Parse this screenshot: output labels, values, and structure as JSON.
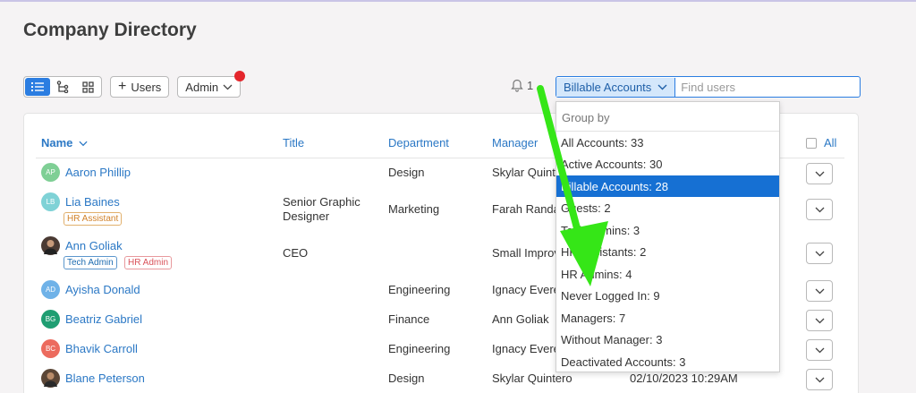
{
  "page": {
    "title": "Company Directory"
  },
  "toolbar": {
    "add_users_label": "Users",
    "role_select": "Admin"
  },
  "notifications": {
    "count": "1"
  },
  "search": {
    "filter_chip": "Billable Accounts",
    "placeholder": "Find users"
  },
  "table": {
    "headers": {
      "name": "Name",
      "title": "Title",
      "department": "Department",
      "manager": "Manager",
      "all": "All"
    },
    "rows": [
      {
        "initials": "AP",
        "avatar_color": "#7fcf95",
        "name": "Aaron Phillip",
        "title_line1": "",
        "title_line2": "",
        "department": "Design",
        "manager": "Skylar Quinte",
        "date": ""
      },
      {
        "initials": "LB",
        "avatar_color": "#7fd2d6",
        "name": "Lia Baines",
        "badge1": "HR Assistant",
        "title_line1": "Senior Graphic",
        "title_line2": "Designer",
        "department": "Marketing",
        "manager": "Farah Randa",
        "date": ""
      },
      {
        "initials": "",
        "avatar_color": "#4a3a33",
        "name": "Ann Goliak",
        "badge1": "Tech Admin",
        "badge2": "HR Admin",
        "title_line1": "CEO",
        "title_line2": "",
        "department": "",
        "manager": "Small Improv",
        "date": ""
      },
      {
        "initials": "AD",
        "avatar_color": "#6fb2e8",
        "name": "Ayisha Donald",
        "title_line1": "",
        "title_line2": "",
        "department": "Engineering",
        "manager": "Ignacy Evere",
        "date": ""
      },
      {
        "initials": "BG",
        "avatar_color": "#1f9e72",
        "name": "Beatriz Gabriel",
        "title_line1": "",
        "title_line2": "",
        "department": "Finance",
        "manager": "Ann Goliak",
        "date": ""
      },
      {
        "initials": "BC",
        "avatar_color": "#ec6b5e",
        "name": "Bhavik Carroll",
        "title_line1": "",
        "title_line2": "",
        "department": "Engineering",
        "manager": "Ignacy Evere",
        "date": ""
      },
      {
        "initials": "",
        "avatar_color": "#5b4636",
        "name": "Blane Peterson",
        "title_line1": "",
        "title_line2": "",
        "department": "Design",
        "manager": "Skylar Quintero",
        "date": "02/10/2023 10:29AM"
      }
    ]
  },
  "dropdown": {
    "header": "Group by",
    "items": [
      "All Accounts: 33",
      "Active Accounts: 30",
      "Billable Accounts: 28",
      "Guests: 2",
      "Tech Admins: 3",
      "HR Assistants: 2",
      "HR Admins: 4",
      "Never Logged In: 9",
      "Managers: 7",
      "Without Manager: 3",
      "Deactivated Accounts: 3"
    ],
    "selected": "Billable Accounts: 28"
  },
  "colors": {
    "accent": "#2b7de1",
    "link": "#2b78c5",
    "selected_bg": "#1670d3",
    "arrow": "#35e617",
    "notification_dot": "#e4262c"
  },
  "icons": [
    "list-view-icon",
    "org-chart-icon",
    "grid-view-icon",
    "plus-icon",
    "chevron-down-icon",
    "bell-icon"
  ]
}
